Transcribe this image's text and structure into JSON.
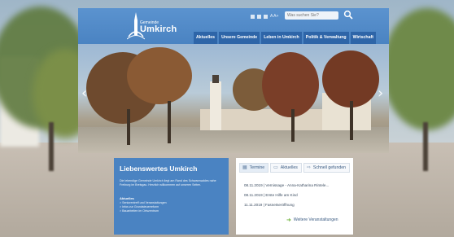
{
  "logo": {
    "small_text": "Gemeinde",
    "name": "Umkirch"
  },
  "toolbar": {
    "font_size_controls": "A A+",
    "search_placeholder": "Was suchen Sie?"
  },
  "nav": {
    "items": [
      {
        "label": "Aktuelles"
      },
      {
        "label": "Unsere Gemeinde"
      },
      {
        "label": "Leben in Umkirch"
      },
      {
        "label": "Politik & Verwaltung"
      },
      {
        "label": "Wirtschaft"
      }
    ]
  },
  "hero": {
    "prev_arrow": "‹",
    "next_arrow": "›"
  },
  "feature": {
    "title": "Liebenswertes Umkirch",
    "text": "Die lebendige Gemeinde Umkirch liegt am Rand des Schwarzwaldes nahe Freiburg im Breisgau. Herzlich willkommen auf unseren Seiten.",
    "subtitle": "Aktuelles",
    "list": [
      "> Seniorentreff und Veranstaltungen",
      "> Infos zur Grundsteuerreform",
      "> Bauarbeiten im Ortszentrum"
    ]
  },
  "events": {
    "tabs": [
      {
        "label": "Termine",
        "icon": "calendar-icon"
      },
      {
        "label": "Aktuelles",
        "icon": "speech-bubble-icon"
      },
      {
        "label": "Schnell gefunden",
        "icon": "arrow-icon"
      }
    ],
    "items": [
      {
        "text": "08.11.2019 | Vernissage - Anna-Katharina Rintele..."
      },
      {
        "text": "08.11.2019 | Erste Hilfe am Kind"
      },
      {
        "text": "11.11.2019 | Fasnetseröffnung"
      }
    ],
    "more_label": "Weitere Veranstaltungen"
  },
  "colors": {
    "header": "#4a83c2",
    "nav": "#2e65a8",
    "accent_green": "#6fb33a"
  }
}
